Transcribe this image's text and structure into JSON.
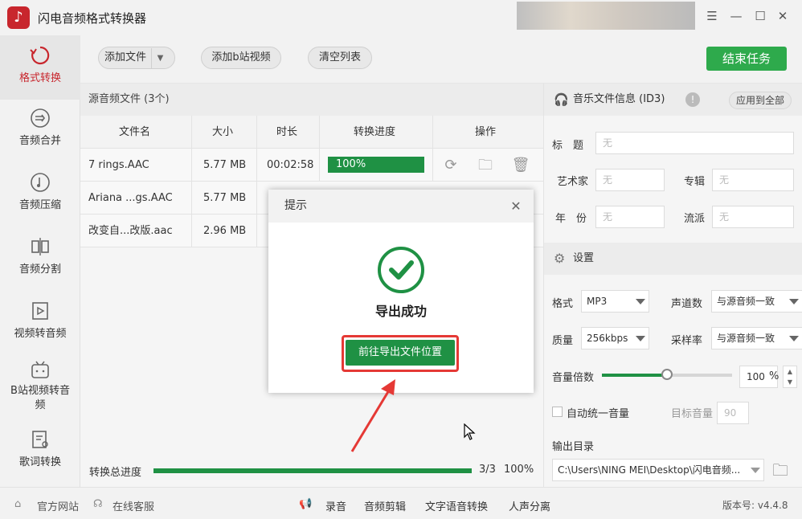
{
  "app": {
    "title": "闪电音频格式转换器",
    "logo_icon": "music-note-icon"
  },
  "window": {
    "controls": [
      "menu-icon",
      "minimize-icon",
      "maximize-icon",
      "close-icon"
    ]
  },
  "nav": {
    "items": [
      {
        "label": "格式转换",
        "icon": "refresh-icon",
        "active": true
      },
      {
        "label": "音频合并",
        "icon": "merge-icon"
      },
      {
        "label": "音频压缩",
        "icon": "compress-icon"
      },
      {
        "label": "音频分割",
        "icon": "split-icon"
      },
      {
        "label": "视频转音频",
        "icon": "video-audio-icon"
      },
      {
        "label": "B站视频转音频",
        "icon": "bilibili-icon"
      },
      {
        "label": "歌词转换",
        "icon": "lyrics-icon"
      }
    ]
  },
  "toolbar": {
    "add_file": "添加文件",
    "add_bilibili": "添加b站视频",
    "clear_list": "清空列表",
    "end_task": "结束任务"
  },
  "files": {
    "header": "源音频文件 (3个)",
    "columns": [
      "文件名",
      "大小",
      "时长",
      "转换进度",
      "操作"
    ],
    "rows": [
      {
        "name": "7 rings.AAC",
        "size": "5.77 MB",
        "duration": "00:02:58",
        "progress": "100%"
      },
      {
        "name": "Ariana ...gs.AAC",
        "size": "5.77 MB",
        "duration": "",
        "progress": ""
      },
      {
        "name": "改变自...改版.aac",
        "size": "2.96 MB",
        "duration": "",
        "progress": ""
      }
    ]
  },
  "total": {
    "label": "转换总进度",
    "count": "3/3",
    "percent": "100%",
    "fraction": 1.0
  },
  "id3": {
    "title": "音乐文件信息 (ID3)",
    "apply_all": "应用到全部",
    "fields": {
      "title_label": "标　题",
      "title_ph": "无",
      "artist_label": "艺术家",
      "artist_ph": "无",
      "album_label": "专辑",
      "album_ph": "无",
      "year_label": "年　份",
      "year_ph": "无",
      "genre_label": "流派",
      "genre_ph": "无"
    }
  },
  "settings": {
    "title": "设置",
    "format_label": "格式",
    "format_value": "MP3",
    "channels_label": "声道数",
    "channels_value": "与源音频一致",
    "quality_label": "质量",
    "quality_value": "256kbps",
    "samplerate_label": "采样率",
    "samplerate_value": "与源音频一致",
    "volume_label": "音量倍数",
    "volume_value": "100",
    "volume_unit": "%",
    "volume_level": 0.5,
    "auto_volume_label": "自动统一音量",
    "target_volume_label": "目标音量",
    "target_volume_value": "90",
    "output_label": "输出目录",
    "output_path": "C:\\Users\\NING MEI\\Desktop\\闪电音频..."
  },
  "statusbar": {
    "website": "官方网站",
    "support": "在线客服",
    "record": "录音",
    "edit": "音频剪辑",
    "tts": "文字语音转换",
    "vocal": "人声分离",
    "version": "版本号: v4.4.8"
  },
  "modal": {
    "title": "提示",
    "message": "导出成功",
    "goto_button": "前往导出文件位置"
  },
  "colors": {
    "accent": "#1f9144",
    "brand": "#c8262d",
    "highlight": "#e53935"
  }
}
